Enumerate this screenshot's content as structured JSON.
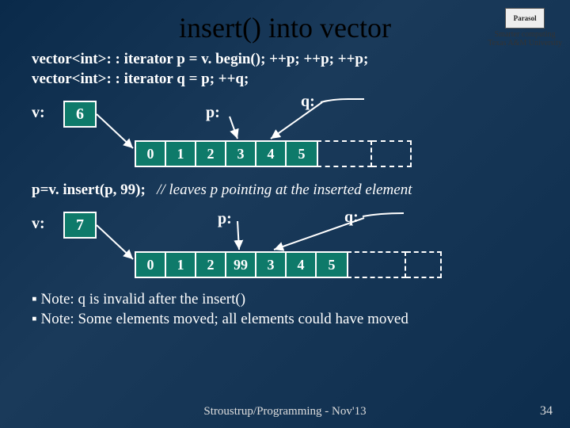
{
  "title": "insert() into vector",
  "logo": {
    "text": "Parasol",
    "tag1": "Smarter computing",
    "tag2": "Texas A&M University"
  },
  "code": {
    "line1": "vector<int>: : iterator p = v. begin(); ++p; ++p; ++p;",
    "line2": "vector<int>: : iterator q = p; ++q;"
  },
  "diagram1": {
    "vlabel": "v:",
    "size": "6",
    "plabel": "p:",
    "qlabel": "q:",
    "cells": [
      "0",
      "1",
      "2",
      "3",
      "4",
      "5"
    ]
  },
  "comment": {
    "lhs": "p=v. insert(p, 99);",
    "rhs": "// leaves p pointing at the inserted element"
  },
  "diagram2": {
    "vlabel": "v:",
    "size": "7",
    "plabel": "p:",
    "qlabel": "q:",
    "cells": [
      "0",
      "1",
      "2",
      "99",
      "3",
      "4",
      "5"
    ]
  },
  "notes": {
    "n1": "Note: q is invalid after the insert()",
    "n2": "Note: Some elements moved; all elements could have moved"
  },
  "footer": "Stroustrup/Programming - Nov'13",
  "pagenum": "34"
}
